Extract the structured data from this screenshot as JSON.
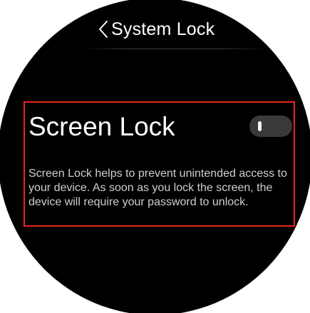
{
  "header": {
    "title": "System Lock",
    "back_icon": "chevron-left-icon"
  },
  "setting": {
    "title": "Screen Lock",
    "toggle_state": "off",
    "description": "Screen Lock helps to prevent unintended access to your device. As soon as you lock the screen, the device will require your password to unlock."
  },
  "colors": {
    "background": "#000000",
    "text_primary": "#ffffff",
    "text_secondary": "#cfcfcf",
    "toggle_track": "#3a3a3a",
    "highlight_border": "#e8261f"
  }
}
